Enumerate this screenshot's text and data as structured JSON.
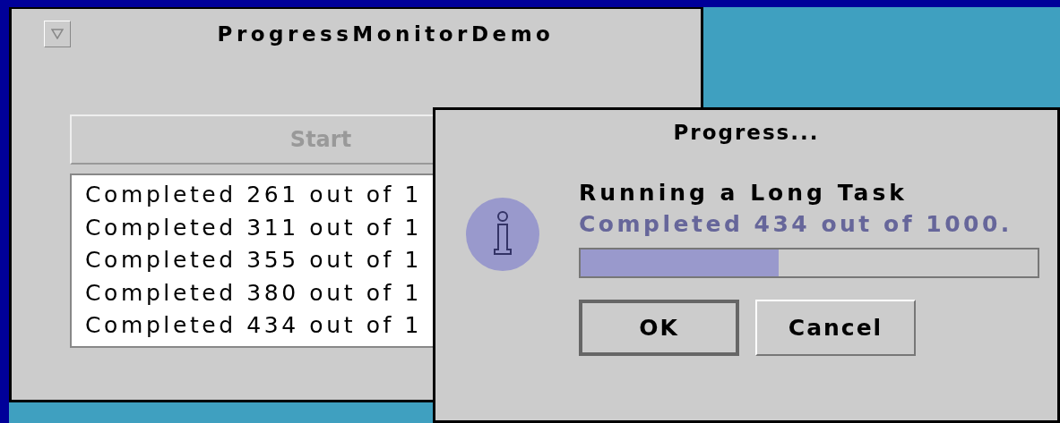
{
  "window": {
    "title": "ProgressMonitorDemo"
  },
  "start_button": {
    "label": "Start",
    "disabled": true
  },
  "log": [
    "Completed 261 out of 1",
    "Completed 311 out of 1",
    "Completed 355 out of 1",
    "Completed 380 out of 1",
    "Completed 434 out of 1"
  ],
  "dialog": {
    "title": "Progress...",
    "message": "Running a Long Task",
    "note": "Completed 434 out of 1000.",
    "progress": {
      "level": 0.434
    },
    "buttons": [
      {
        "label": "OK",
        "default": true
      },
      {
        "label": "Cancel",
        "default": false
      }
    ]
  }
}
